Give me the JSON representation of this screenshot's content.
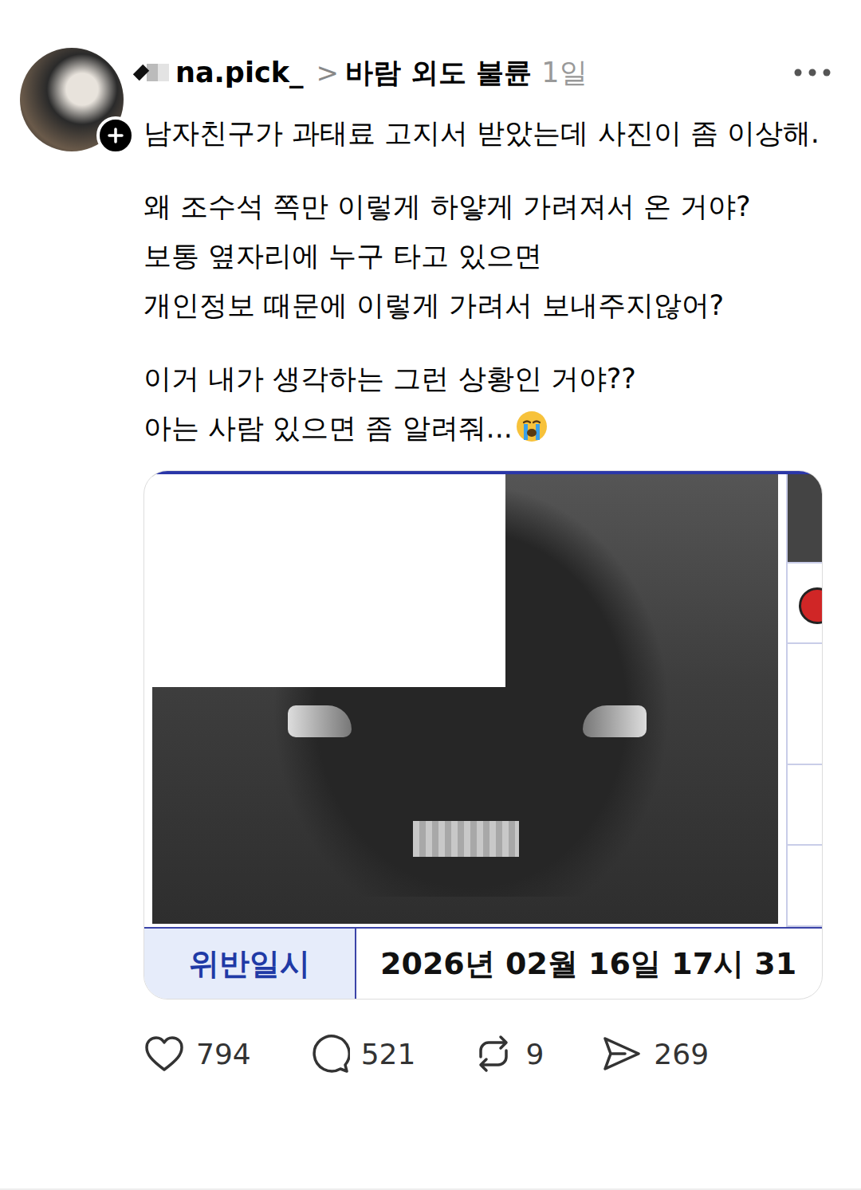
{
  "post": {
    "username": "na.pick_",
    "separator": ">",
    "topic": "바람 외도 불륜",
    "time": "1일",
    "paragraphs": [
      [
        "남자친구가 과태료 고지서 받았는데 사진이 좀 이상해."
      ],
      [
        "왜 조수석 쪽만 이렇게 하얗게 가려져서 온 거야?",
        "보통 옆자리에 누구 타고 있으면",
        "개인정보 때문에 이렇게 가려서 보내주지않어?"
      ],
      [
        "이거 내가 생각하는 그런 상황인 거야??",
        "아는 사람 있으면 좀 알려줘..."
      ]
    ]
  },
  "notice": {
    "label": "위반일시",
    "value": "2026년 02월 16일 17시 31"
  },
  "actions": [
    {
      "kind": "like",
      "count": "794"
    },
    {
      "kind": "comment",
      "count": "521"
    },
    {
      "kind": "repost",
      "count": "9"
    },
    {
      "kind": "share",
      "count": "269"
    }
  ]
}
